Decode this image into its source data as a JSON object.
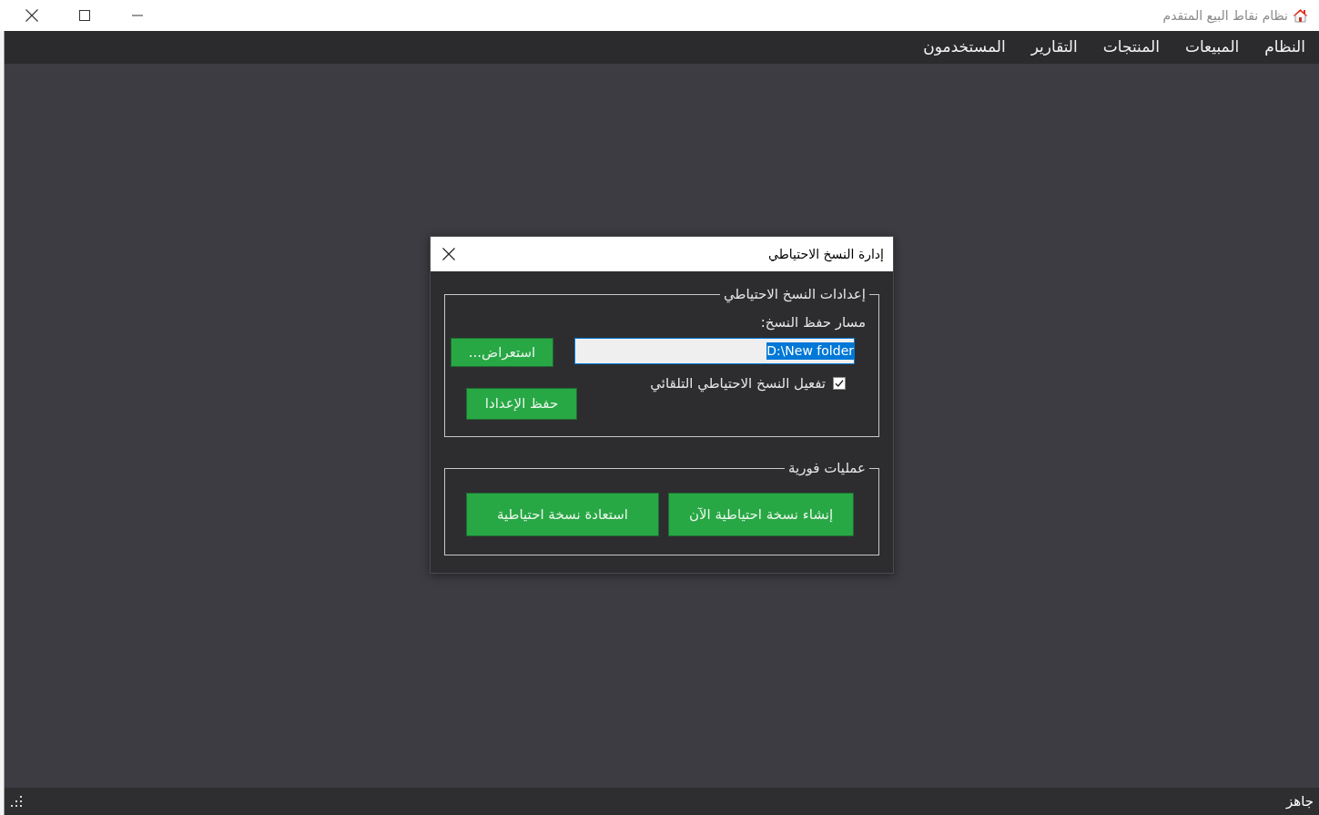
{
  "window": {
    "title": "نظام نقاط البيع المتقدم"
  },
  "menu": [
    "النظام",
    "المبيعات",
    "المنتجات",
    "التقارير",
    "المستخدمون"
  ],
  "dialog": {
    "title": "إدارة النسخ الاحتياطي",
    "settings_group": {
      "legend": "إعدادات النسخ الاحتياطي",
      "path_label": "مسار حفظ النسخ:",
      "path_field": {
        "value": "D:\\New folder",
        "text_selected": true
      },
      "browse_button": "استعراض...",
      "auto_backup": {
        "label": "تفعيل النسخ الاحتياطي التلقائي",
        "checked": true
      },
      "save_button": "حفظ الإعدادا"
    },
    "actions_group": {
      "legend": "عمليات فورية",
      "buttons": [
        "إنشاء نسخة احتياطية الآن",
        "استعادة نسخة احتياطية"
      ]
    }
  },
  "status_bar": {
    "text": "جاهز"
  }
}
